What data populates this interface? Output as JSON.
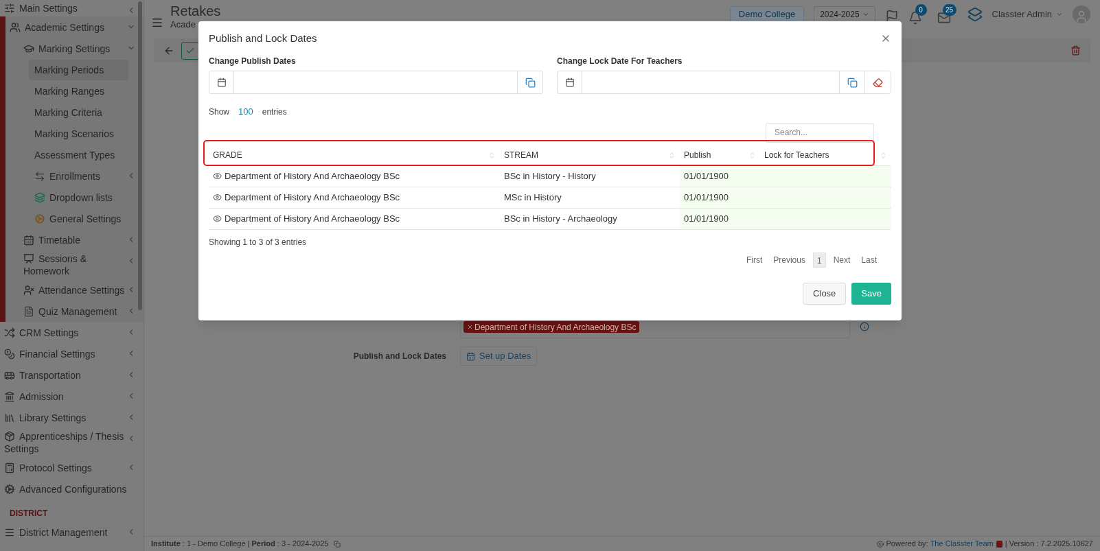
{
  "sidebar": {
    "items": [
      {
        "label": "Main Settings",
        "selected": false,
        "expanded": false
      },
      {
        "label": "Academic Settings",
        "selected": false,
        "expanded": true,
        "children": [
          {
            "label": "Marking Settings",
            "selected": false,
            "expanded": true,
            "children": [
              {
                "label": "Marking Periods",
                "selected": true
              },
              {
                "label": "Marking Ranges",
                "selected": false
              },
              {
                "label": "Marking Criteria",
                "selected": false
              },
              {
                "label": "Marking Scenarios",
                "selected": false
              },
              {
                "label": "Assessment Types",
                "selected": false
              },
              {
                "label": "Enrollments",
                "selected": false,
                "expanded": false
              },
              {
                "label": "Dropdown lists",
                "selected": false
              },
              {
                "label": "General Settings",
                "selected": false
              }
            ]
          },
          {
            "label": "Timetable",
            "selected": false,
            "expanded": false
          },
          {
            "label": "Sessions & Homework",
            "selected": false,
            "expanded": false
          },
          {
            "label": "Attendance Settings",
            "selected": false,
            "expanded": false
          },
          {
            "label": "Quiz Management",
            "selected": false,
            "expanded": false
          }
        ]
      },
      {
        "label": "CRM Settings",
        "selected": false,
        "expanded": false
      },
      {
        "label": "Financial Settings",
        "selected": false,
        "expanded": false
      },
      {
        "label": "Transportation",
        "selected": false,
        "expanded": false
      },
      {
        "label": "Admission",
        "selected": false,
        "expanded": false
      },
      {
        "label": "Library Settings",
        "selected": false,
        "expanded": false
      },
      {
        "label": "Apprenticeships / Thesis Settings",
        "selected": false,
        "expanded": false
      },
      {
        "label": "Protocol Settings",
        "selected": false,
        "expanded": false
      },
      {
        "label": "Advanced Configurations",
        "selected": false
      }
    ],
    "district_heading": "DISTRICT",
    "district_items": [
      {
        "label": "District Management",
        "selected": false,
        "expanded": false
      }
    ]
  },
  "header": {
    "title": "Retakes",
    "subtitle": "Acade",
    "college": "Demo College",
    "year": "2024-2025",
    "notifications": "0",
    "messages": "25",
    "user": "Classter Admin"
  },
  "form": {
    "tag": "Department of History And Archaeology BSc",
    "dates_label": "Publish and Lock Dates",
    "dates_button": "Set up Dates"
  },
  "footer": {
    "info": "**Institute** : 1 - Demo College | **Period** : 3 - 2024-2025",
    "powered_by": "Powered by:",
    "team": "The Classter Team",
    "version": "| Version : 7.2.2025.10627"
  },
  "modal": {
    "title": "Publish and Lock Dates",
    "fields": [
      {
        "label": "Change Publish Dates",
        "kind": "copy"
      },
      {
        "label": "Change Lock Date For Teachers",
        "kind": "copy_clear"
      }
    ],
    "show": "Show",
    "page_size": "100",
    "entries": "entries",
    "search_placeholder": "Search...",
    "header_highlighted": true,
    "columns": [
      "GRADE",
      "STREAM",
      "Publish",
      "Lock for Teachers"
    ],
    "rows": [
      {
        "grade": "Department of History And Archaeology BSc",
        "stream": "BSc in History - History",
        "publish": "01/01/1900"
      },
      {
        "grade": "Department of History And Archaeology BSc",
        "stream": "MSc in History",
        "publish": "01/01/1900"
      },
      {
        "grade": "Department of History And Archaeology BSc",
        "stream": "BSc in History - Archaeology",
        "publish": "01/01/1900"
      }
    ],
    "info": "Showing 1 to 3 of 3 entries",
    "pages": [
      {
        "label": "First",
        "selected": false
      },
      {
        "label": "Previous",
        "selected": false
      },
      {
        "label": "1",
        "selected": true
      },
      {
        "label": "Next",
        "selected": false
      },
      {
        "label": "Last",
        "selected": false
      }
    ],
    "buttons": [
      {
        "label": "Close",
        "kind": "secondary"
      },
      {
        "label": "Save",
        "kind": "primary"
      }
    ]
  }
}
